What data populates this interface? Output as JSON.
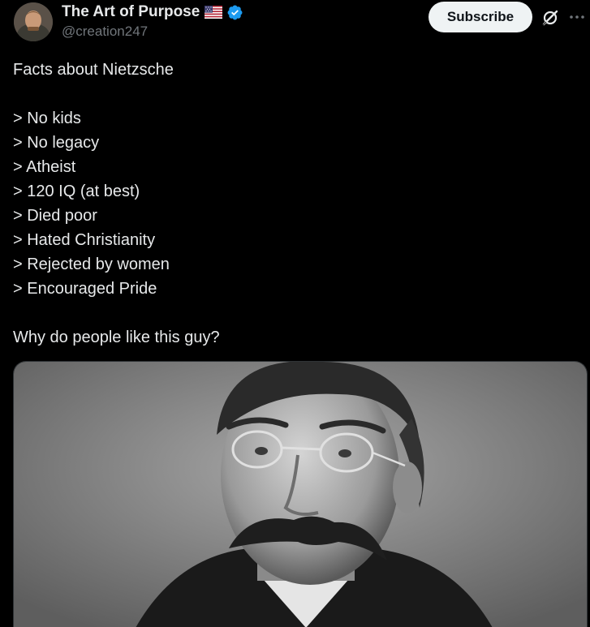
{
  "author": {
    "display_name": "The Art of Purpose",
    "handle": "@creation247",
    "flag": "us-flag-icon",
    "verified": true,
    "verified_color": "#1d9bf0"
  },
  "actions": {
    "subscribe_label": "Subscribe",
    "grok_icon": "grok-icon",
    "more_icon": "more-icon"
  },
  "tweet": {
    "lines": [
      "Facts about Nietzsche",
      "",
      "> No kids",
      "> No legacy",
      "> Atheist",
      "> 120 IQ (at best)",
      "> Died poor",
      "> Hated Christianity",
      "> Rejected by women",
      "> Encouraged Pride",
      "",
      "Why do people like this guy?"
    ]
  },
  "media": {
    "type": "photo",
    "description_icon": "portrait-photo"
  },
  "colors": {
    "background": "#000000",
    "text": "#e7e9ea",
    "secondary_text": "#71767b",
    "button_bg": "#eff3f4"
  }
}
